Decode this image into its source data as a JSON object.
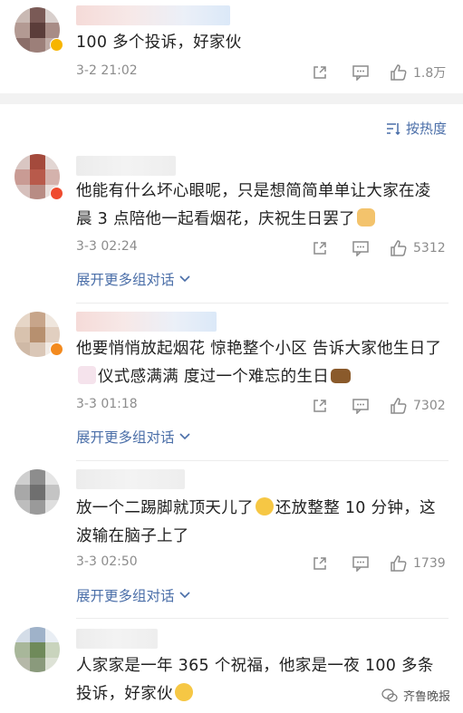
{
  "sort": {
    "label": "按热度"
  },
  "comments": [
    {
      "text": "100 多个投诉，好家伙",
      "time": "3-2 21:02",
      "likes": "1.8万",
      "expand": ""
    },
    {
      "text_a": "他能有什么坏心眼呢，只是想简简单单让大家在凌晨 3 点陪他一起看烟花，庆祝生日罢了",
      "emoji": "doge-emoji",
      "time": "3-3 02:24",
      "likes": "5312",
      "expand": "展开更多组对话"
    },
    {
      "text_a": "他要悄悄放起烟花 惊艳整个小区 告诉大家他生日了",
      "text_b": "仪式感满满 度过一个难忘的生日",
      "emoji_1": "cake-emoji",
      "emoji_2": "ox-emoji",
      "time": "3-3 01:18",
      "likes": "7302",
      "expand": "展开更多组对话"
    },
    {
      "text_a": "放一个二踢脚就顶天儿了",
      "text_b": "还放整整 10 分钟，这波输在脑子上了",
      "emoji": "smirk-emoji",
      "time": "3-3 02:50",
      "likes": "1739",
      "expand": "展开更多组对话"
    },
    {
      "text_a": "人家家是一年 365 个祝福，他家是一夜 100 多条投诉，好家伙",
      "emoji": "laugh-cry-emoji"
    }
  ],
  "watermark": {
    "label": "齐鲁晚报"
  },
  "colors": {
    "link": "#4a6ea8",
    "meta": "#8c8c8c",
    "separator": "#f2f2f2"
  }
}
